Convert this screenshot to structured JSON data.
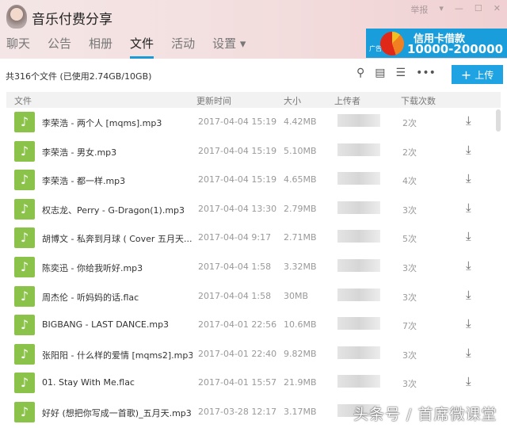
{
  "header": {
    "title": "音乐付费分享",
    "report": "举报",
    "nav": [
      "聊天",
      "公告",
      "相册",
      "文件",
      "活动",
      "设置 ▾"
    ],
    "active": 3
  },
  "ad": {
    "tag": "广告",
    "line1": "信用卡借款",
    "line2": "10000-200000"
  },
  "toolbar": {
    "count": "共316个文件 (已使用2.74GB/10GB)",
    "upload": "上传"
  },
  "columns": [
    "文件",
    "更新时间",
    "大小",
    "上传者",
    "下载次数"
  ],
  "files": [
    {
      "name": "李荣浩 - 两个人 [mqms].mp3",
      "time": "2017-04-04 15:19",
      "size": "4.42MB",
      "downloads": "2次"
    },
    {
      "name": "李荣浩 - 男女.mp3",
      "time": "2017-04-04 15:19",
      "size": "5.10MB",
      "downloads": "2次"
    },
    {
      "name": "李荣浩 - 都一样.mp3",
      "time": "2017-04-04 15:19",
      "size": "4.65MB",
      "downloads": "4次"
    },
    {
      "name": "权志龙、Perry - G-Dragon(1).mp3",
      "time": "2017-04-04 13:30",
      "size": "2.79MB",
      "downloads": "3次"
    },
    {
      "name": "胡博文 - 私奔到月球 ( Cover 五月天...",
      "time": "2017-04-04 9:17",
      "size": "2.71MB",
      "downloads": "5次"
    },
    {
      "name": "陈奕迅 - 你给我听好.mp3",
      "time": "2017-04-04 1:58",
      "size": "3.32MB",
      "downloads": "3次"
    },
    {
      "name": "周杰伦 - 听妈妈的话.flac",
      "time": "2017-04-04 1:58",
      "size": "30MB",
      "downloads": "3次"
    },
    {
      "name": "BIGBANG - LAST DANCE.mp3",
      "time": "2017-04-01 22:56",
      "size": "10.6MB",
      "downloads": "7次"
    },
    {
      "name": "张阳阳 - 什么样的爱情 [mqms2].mp3",
      "time": "2017-04-01 22:40",
      "size": "9.82MB",
      "downloads": "3次"
    },
    {
      "name": "01. Stay With Me.flac",
      "time": "2017-04-01 15:57",
      "size": "21.9MB",
      "downloads": "3次"
    },
    {
      "name": "好好 (想把你写成一首歌)_五月天.mp3",
      "time": "2017-03-28 12:17",
      "size": "3.17MB",
      "downloads": ""
    }
  ],
  "watermark": "头条号 / 首席微课堂"
}
